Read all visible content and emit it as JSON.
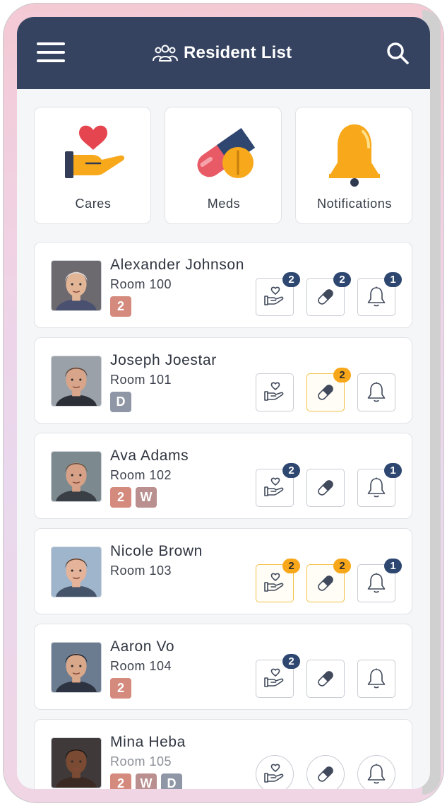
{
  "header": {
    "title": "Resident List",
    "menu_icon": "hamburger-menu-icon",
    "title_icon": "people-group-icon",
    "search_icon": "search-icon",
    "background_color": "#354360"
  },
  "categories": [
    {
      "label": "Cares",
      "icon": "heart-hand-icon"
    },
    {
      "label": "Meds",
      "icon": "pills-icon"
    },
    {
      "label": "Notifications",
      "icon": "bell-icon"
    }
  ],
  "colors": {
    "tag_count": "#d48a7c",
    "tag_W": "#b98f8f",
    "tag_D": "#8f97a6",
    "badge_navy": "#2e4770",
    "badge_orange": "#f9a71a",
    "active_border": "#f3c24a"
  },
  "residents": [
    {
      "name": "Alexander Johnson",
      "room": "Room 100",
      "tags": [
        "2"
      ],
      "cares": {
        "badge": "2",
        "active": false
      },
      "meds": {
        "badge": "2",
        "active": false
      },
      "notifications": {
        "badge": "1",
        "active": false
      }
    },
    {
      "name": "Joseph Joestar",
      "room": "Room 101",
      "tags": [
        "D"
      ],
      "cares": {
        "badge": null,
        "active": false
      },
      "meds": {
        "badge": "2",
        "active": true
      },
      "notifications": {
        "badge": null,
        "active": false
      }
    },
    {
      "name": "Ava Adams",
      "room": "Room 102",
      "tags": [
        "2",
        "W"
      ],
      "cares": {
        "badge": "2",
        "active": false
      },
      "meds": {
        "badge": null,
        "active": false
      },
      "notifications": {
        "badge": "1",
        "active": false
      }
    },
    {
      "name": "Nicole Brown",
      "room": "Room 103",
      "tags": [],
      "cares": {
        "badge": "2",
        "active": true
      },
      "meds": {
        "badge": "2",
        "active": true
      },
      "notifications": {
        "badge": "1",
        "active": false
      }
    },
    {
      "name": "Aaron Vo",
      "room": "Room 104",
      "tags": [
        "2"
      ],
      "cares": {
        "badge": "2",
        "active": false
      },
      "meds": {
        "badge": null,
        "active": false
      },
      "notifications": {
        "badge": null,
        "active": false
      }
    },
    {
      "name": "Mina Heba",
      "room": "Room 105",
      "tags": [
        "2",
        "W",
        "D"
      ],
      "cares": {
        "badge": null,
        "active": false
      },
      "meds": {
        "badge": null,
        "active": false
      },
      "notifications": {
        "badge": null,
        "active": false
      }
    }
  ]
}
